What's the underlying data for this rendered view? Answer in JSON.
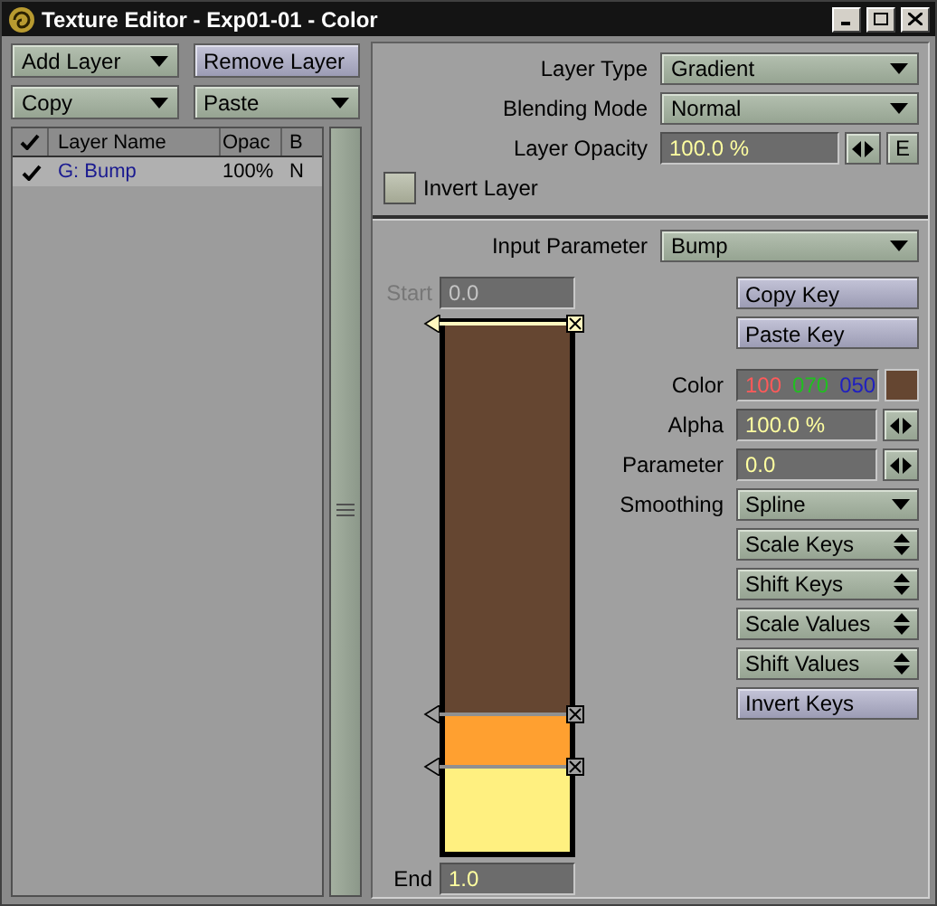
{
  "window": {
    "title": "Texture Editor - Exp01-01 - Color"
  },
  "layer_buttons": [
    {
      "label": "Add Layer",
      "kind": "dropdown"
    },
    {
      "label": "Remove Layer",
      "kind": "action"
    },
    {
      "label": "Copy",
      "kind": "dropdown"
    },
    {
      "label": "Paste",
      "kind": "dropdown"
    }
  ],
  "layer_list": {
    "columns": [
      "Layer Name",
      "Opac",
      "B"
    ],
    "rows": [
      {
        "name": "G: Bump",
        "opacity": "100%",
        "blend": "N",
        "checked": true,
        "selected": true
      }
    ]
  },
  "layer_settings": {
    "layer_type": {
      "label": "Layer Type",
      "value": "Gradient"
    },
    "blending_mode": {
      "label": "Blending Mode",
      "value": "Normal"
    },
    "layer_opacity": {
      "label": "Layer Opacity",
      "value": "100.0 %",
      "envelope": "E"
    },
    "invert_layer": {
      "label": "Invert Layer",
      "checked": false
    }
  },
  "input_parameter": {
    "label": "Input Parameter",
    "value": "Bump"
  },
  "gradient": {
    "start": {
      "label": "Start",
      "value": "0.0",
      "disabled": true
    },
    "end": {
      "label": "End",
      "value": "1.0",
      "disabled": false
    },
    "keys": [
      {
        "color": "#654631",
        "selected": true
      },
      {
        "color": "#ffa030",
        "selected": false
      },
      {
        "color": "#fff080",
        "selected": false
      }
    ]
  },
  "key_buttons": [
    {
      "label": "Copy Key"
    },
    {
      "label": "Paste Key"
    }
  ],
  "key_settings": [
    {
      "kind": "color",
      "label": "Color",
      "r": "100",
      "g": "070",
      "b": "050",
      "color": "#654631"
    },
    {
      "kind": "number",
      "label": "Alpha",
      "value": "100.0 %"
    },
    {
      "kind": "number",
      "label": "Parameter",
      "value": "0.0"
    },
    {
      "kind": "dropdown",
      "label": "Smoothing",
      "value": "Spline"
    }
  ],
  "key_tools": [
    {
      "label": "Scale Keys",
      "kind": "popup"
    },
    {
      "label": "Shift Keys",
      "kind": "popup"
    },
    {
      "label": "Scale Values",
      "kind": "popup"
    },
    {
      "label": "Shift Values",
      "kind": "popup"
    },
    {
      "label": "Invert Keys",
      "kind": "action"
    }
  ]
}
